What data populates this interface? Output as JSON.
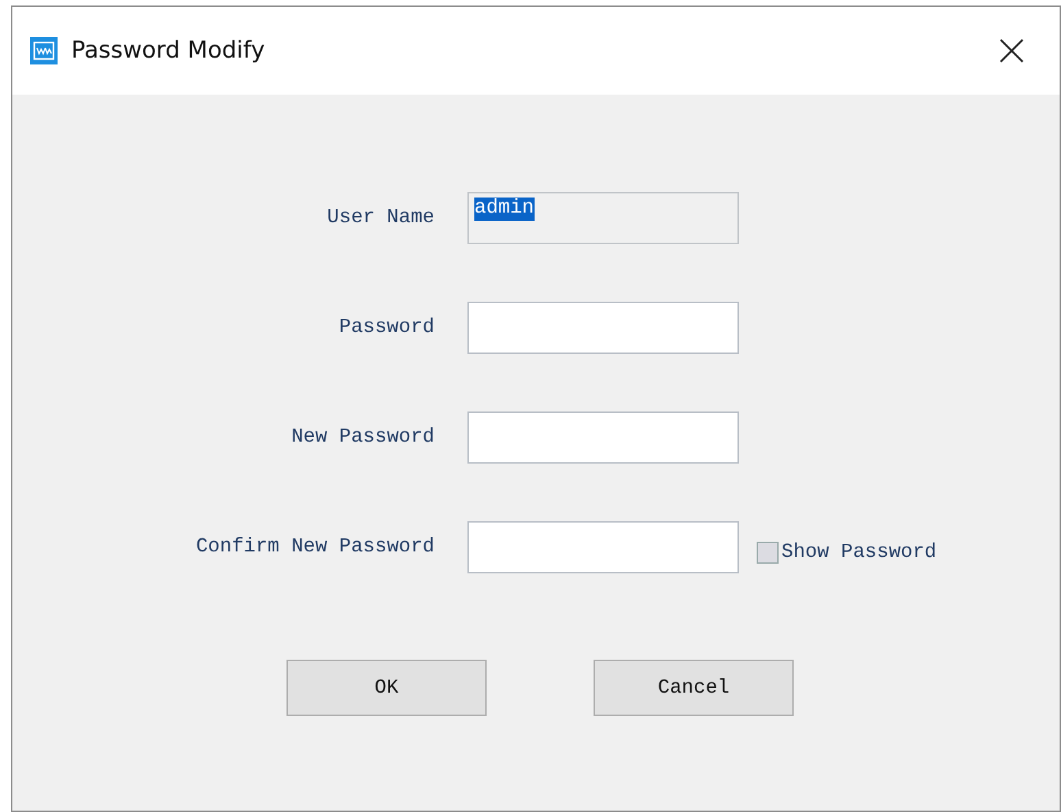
{
  "window": {
    "title": "Password Modify"
  },
  "fields": [
    {
      "label": "User Name",
      "value": "admin",
      "disabled": true,
      "text_selected": true
    },
    {
      "label": "Password",
      "disabled": false
    },
    {
      "label": "New Password",
      "disabled": false
    },
    {
      "label": "Confirm New Password",
      "disabled": false
    }
  ],
  "show_password": {
    "label": "Show Password",
    "checked": false
  },
  "buttons": [
    "OK",
    "Cancel"
  ]
}
